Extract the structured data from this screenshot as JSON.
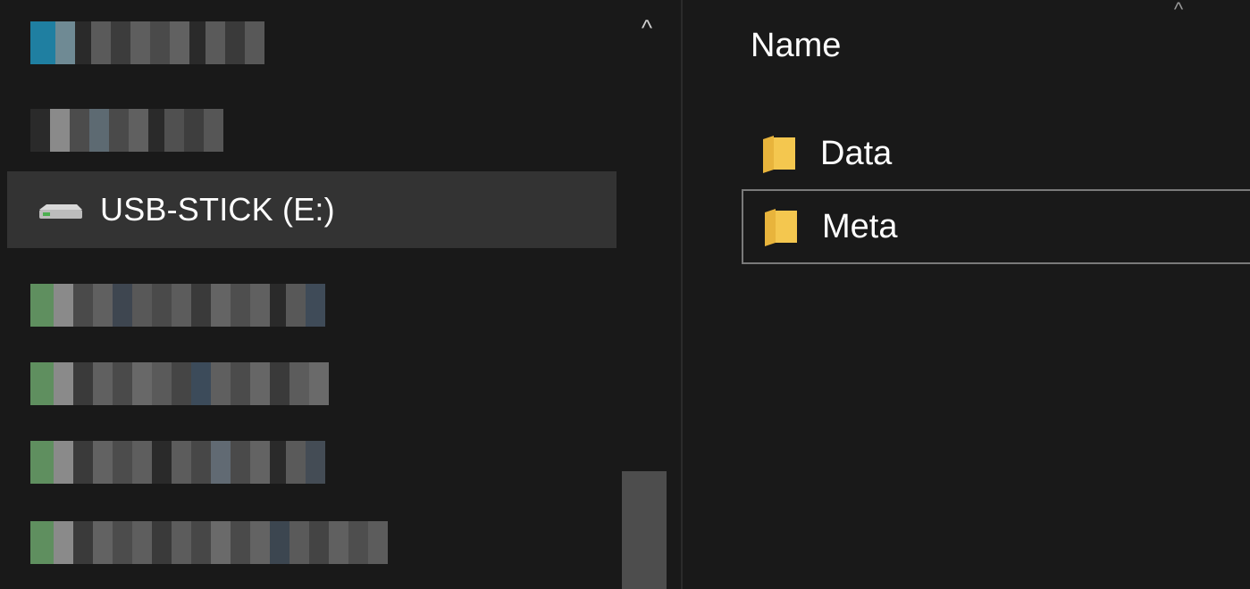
{
  "navigation": {
    "selected_drive_label": "USB-STICK (E:)",
    "scroll_up_glyph": "^"
  },
  "file_list": {
    "sort_indicator": "^",
    "column_name_header": "Name",
    "items": [
      {
        "name": "Data",
        "icon": "folder-icon"
      },
      {
        "name": "Meta",
        "icon": "folder-icon"
      }
    ]
  },
  "colors": {
    "background": "#191919",
    "selected_row": "#333333",
    "folder_yellow": "#f4c74f",
    "text": "#ffffff"
  }
}
